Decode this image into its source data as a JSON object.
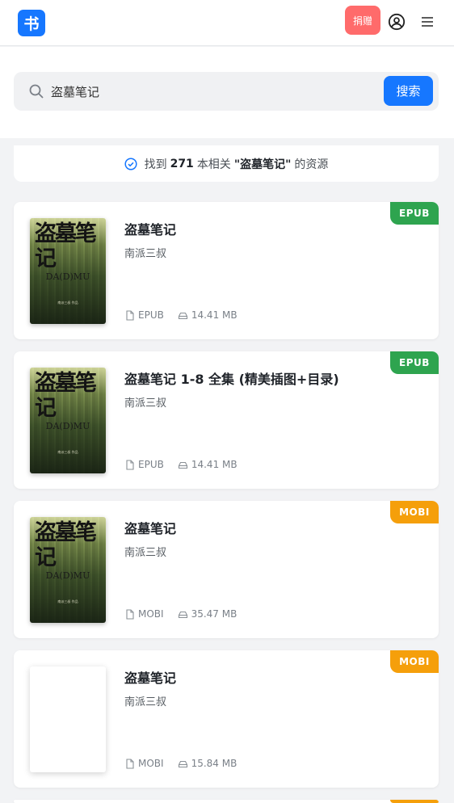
{
  "header": {
    "logo_text": "书",
    "donate_label": "捐赠"
  },
  "search": {
    "value": "盗墓笔记",
    "button_label": "搜索"
  },
  "result_summary": {
    "prefix": "找到",
    "count": "271",
    "middle": "本相关",
    "query": "\"盗墓笔记\"",
    "suffix": "的资源"
  },
  "books": [
    {
      "title": "盗墓笔记",
      "author": "南派三叔",
      "format": "EPUB",
      "size": "14.41 MB",
      "badge": "EPUB",
      "cover": "art"
    },
    {
      "title": "盗墓笔记 1-8 全集 (精美插图+目录)",
      "author": "南派三叔",
      "format": "EPUB",
      "size": "14.41 MB",
      "badge": "EPUB",
      "cover": "art"
    },
    {
      "title": "盗墓笔记",
      "author": "南派三叔",
      "format": "MOBI",
      "size": "35.47 MB",
      "badge": "MOBI",
      "cover": "art"
    },
    {
      "title": "盗墓笔记",
      "author": "南派三叔",
      "format": "MOBI",
      "size": "15.84 MB",
      "badge": "MOBI",
      "cover": "blank"
    }
  ],
  "cover_art": {
    "title": "盗墓笔记",
    "subtitle": "DA(D)MU",
    "credit": "南派三叔 作品"
  },
  "colors": {
    "primary": "#1677ff",
    "donate": "#ff6b6b",
    "epub_badge": "#2ea44f",
    "mobi_badge": "#f59f0b"
  }
}
